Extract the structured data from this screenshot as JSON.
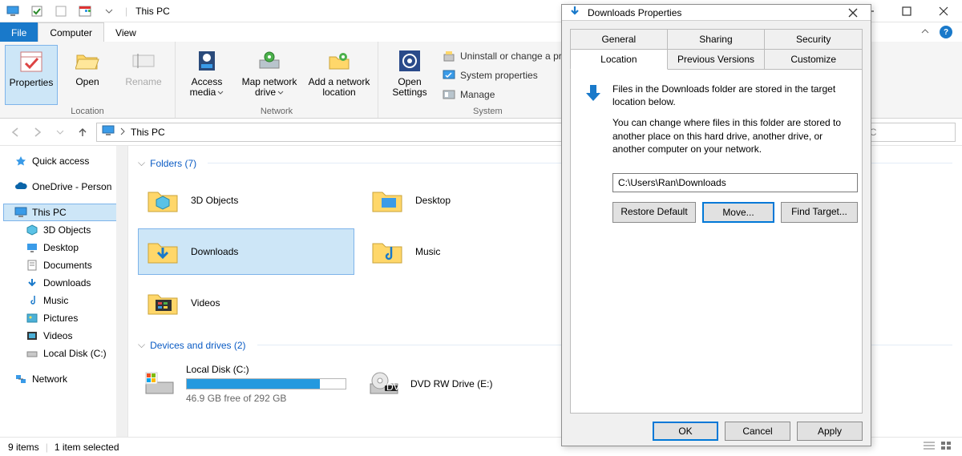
{
  "window": {
    "title": "This PC"
  },
  "ribbon_tabs": {
    "file": "File",
    "computer": "Computer",
    "view": "View"
  },
  "ribbon": {
    "location": {
      "label": "Location",
      "properties": "Properties",
      "open": "Open",
      "rename": "Rename"
    },
    "network": {
      "label": "Network",
      "access_media": "Access media",
      "map_drive": "Map network drive",
      "add_location": "Add a network location"
    },
    "system": {
      "label": "System",
      "open_settings": "Open Settings",
      "uninstall": "Uninstall or change a program",
      "sysprops": "System properties",
      "manage": "Manage"
    }
  },
  "address": {
    "location": "This PC"
  },
  "search": {
    "placeholder": "rch This PC"
  },
  "tree": {
    "quick": "Quick access",
    "onedrive": "OneDrive - Person",
    "thispc": "This PC",
    "objects3d": "3D Objects",
    "desktop": "Desktop",
    "documents": "Documents",
    "downloads": "Downloads",
    "music": "Music",
    "pictures": "Pictures",
    "videos": "Videos",
    "localdisk": "Local Disk (C:)",
    "network": "Network"
  },
  "sections": {
    "folders": "Folders (7)",
    "drives": "Devices and drives (2)"
  },
  "folders": {
    "objects3d": "3D Objects",
    "desktop": "Desktop",
    "downloads": "Downloads",
    "music": "Music",
    "videos": "Videos"
  },
  "drives": {
    "c": {
      "label": "Local Disk (C:)",
      "free": "46.9 GB free of 292 GB",
      "fill_pct": 84
    },
    "e": {
      "label": "DVD RW Drive (E:)"
    }
  },
  "status": {
    "items": "9 items",
    "selected": "1 item selected"
  },
  "dialog": {
    "title": "Downloads Properties",
    "tabs": {
      "general": "General",
      "sharing": "Sharing",
      "security": "Security",
      "location": "Location",
      "previous": "Previous Versions",
      "customize": "Customize"
    },
    "p1": "Files in the Downloads folder are stored in the target location below.",
    "p2": "You can change where files in this folder are stored to another place on this hard drive, another drive, or another computer on your network.",
    "path": "C:\\Users\\Ran\\Downloads",
    "btn_restore": "Restore Default",
    "btn_move": "Move...",
    "btn_find": "Find Target...",
    "ok": "OK",
    "cancel": "Cancel",
    "apply": "Apply"
  }
}
